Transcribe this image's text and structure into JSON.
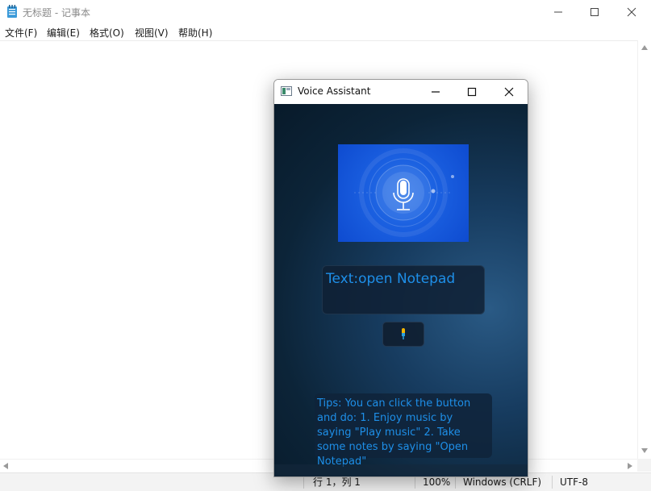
{
  "notepad": {
    "title": "无标题 - 记事本",
    "menu": [
      "文件(F)",
      "编辑(E)",
      "格式(O)",
      "视图(V)",
      "帮助(H)"
    ],
    "status": {
      "position": "行 1，列 1",
      "zoom": "100%",
      "line_ending": "Windows (CRLF)",
      "encoding": "UTF-8"
    },
    "icons": {
      "app": "notepad-icon",
      "minimize": "minimize-icon",
      "maximize": "maximize-icon",
      "close": "close-icon"
    }
  },
  "voice_assistant": {
    "title": "Voice Assistant",
    "recognized_text": "Text:open Notepad",
    "tips": "Tips: You can click the button and do: 1. Enjoy music by saying \"Play music\" 2. Take some notes by saying \"Open Notepad\"",
    "icons": {
      "app": "app-window-icon",
      "banner": "microphone-icon",
      "button": "microphone-icon"
    },
    "colors": {
      "accent_text": "#1e8fe8",
      "banner": "#1a5fe0",
      "background": "#0c2438"
    }
  }
}
